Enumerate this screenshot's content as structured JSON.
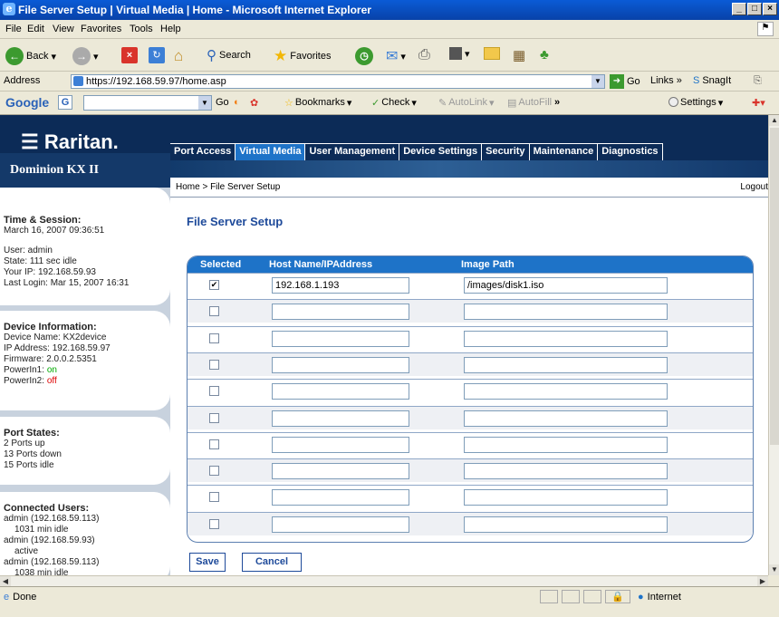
{
  "window": {
    "title": "File Server Setup | Virtual Media | Home - Microsoft Internet Explorer",
    "minimize": "_",
    "maximize": "□",
    "close": "×"
  },
  "menu": [
    "File",
    "Edit",
    "View",
    "Favorites",
    "Tools",
    "Help"
  ],
  "toolbar": {
    "back": "Back",
    "search": "Search",
    "favorites": "Favorites"
  },
  "address": {
    "label": "Address",
    "url": "https://192.168.59.97/home.asp",
    "go": "Go",
    "links": "Links",
    "snagit": "SnagIt"
  },
  "google": {
    "logo": "Google",
    "go": "Go",
    "bookmarks": "Bookmarks",
    "check": "Check",
    "autolink": "AutoLink",
    "autofill": "AutoFill",
    "settings": "Settings"
  },
  "brand": {
    "logo": "Raritan.",
    "product": "Dominion KX II"
  },
  "tabs": [
    "Port Access",
    "Virtual Media",
    "User Management",
    "Device Settings",
    "Security",
    "Maintenance",
    "Diagnostics"
  ],
  "breadcrumb": "Home > File Server Setup",
  "logout": "Logout",
  "session": {
    "heading": "Time & Session:",
    "time": "March 16, 2007 09:36:51",
    "user": "User: admin",
    "state": "State: 111 sec idle",
    "ip": "Your IP: 192.168.59.93",
    "last_login": "Last Login: Mar 15, 2007 16:31"
  },
  "device": {
    "heading": "Device Information:",
    "name": "Device Name: KX2device",
    "ip": "IP Address: 192.168.59.97",
    "firmware": "Firmware: 2.0.0.2.5351",
    "p1_label": "PowerIn1: ",
    "p1": "on",
    "p2_label": "PowerIn2: ",
    "p2": "off"
  },
  "ports": {
    "heading": "Port States:",
    "up": "2 Ports up",
    "down": "13 Ports down",
    "idle": "15 Ports idle"
  },
  "users": {
    "heading": "Connected Users:",
    "list": [
      "admin (192.168.59.113)",
      "1031 min idle",
      "admin (192.168.59.93)",
      "active",
      "admin (192.168.59.113)",
      "1038 min idle"
    ]
  },
  "page_title": "File Server Setup",
  "table": {
    "headers": [
      "Selected",
      "Host Name/IPAddress",
      "Image Path"
    ],
    "rows": [
      {
        "selected": true,
        "host": "192.168.1.193",
        "path": "/images/disk1.iso"
      },
      {
        "selected": false,
        "host": "",
        "path": ""
      },
      {
        "selected": false,
        "host": "",
        "path": ""
      },
      {
        "selected": false,
        "host": "",
        "path": ""
      },
      {
        "selected": false,
        "host": "",
        "path": ""
      },
      {
        "selected": false,
        "host": "",
        "path": ""
      },
      {
        "selected": false,
        "host": "",
        "path": ""
      },
      {
        "selected": false,
        "host": "",
        "path": ""
      },
      {
        "selected": false,
        "host": "",
        "path": ""
      },
      {
        "selected": false,
        "host": "",
        "path": ""
      }
    ]
  },
  "buttons": {
    "save": "Save",
    "cancel": "Cancel"
  },
  "status": {
    "done": "Done",
    "zone": "Internet"
  },
  "colors": {
    "navy": "#0c2b57",
    "accent": "#1e73c8",
    "title": "#1e4a9a"
  }
}
